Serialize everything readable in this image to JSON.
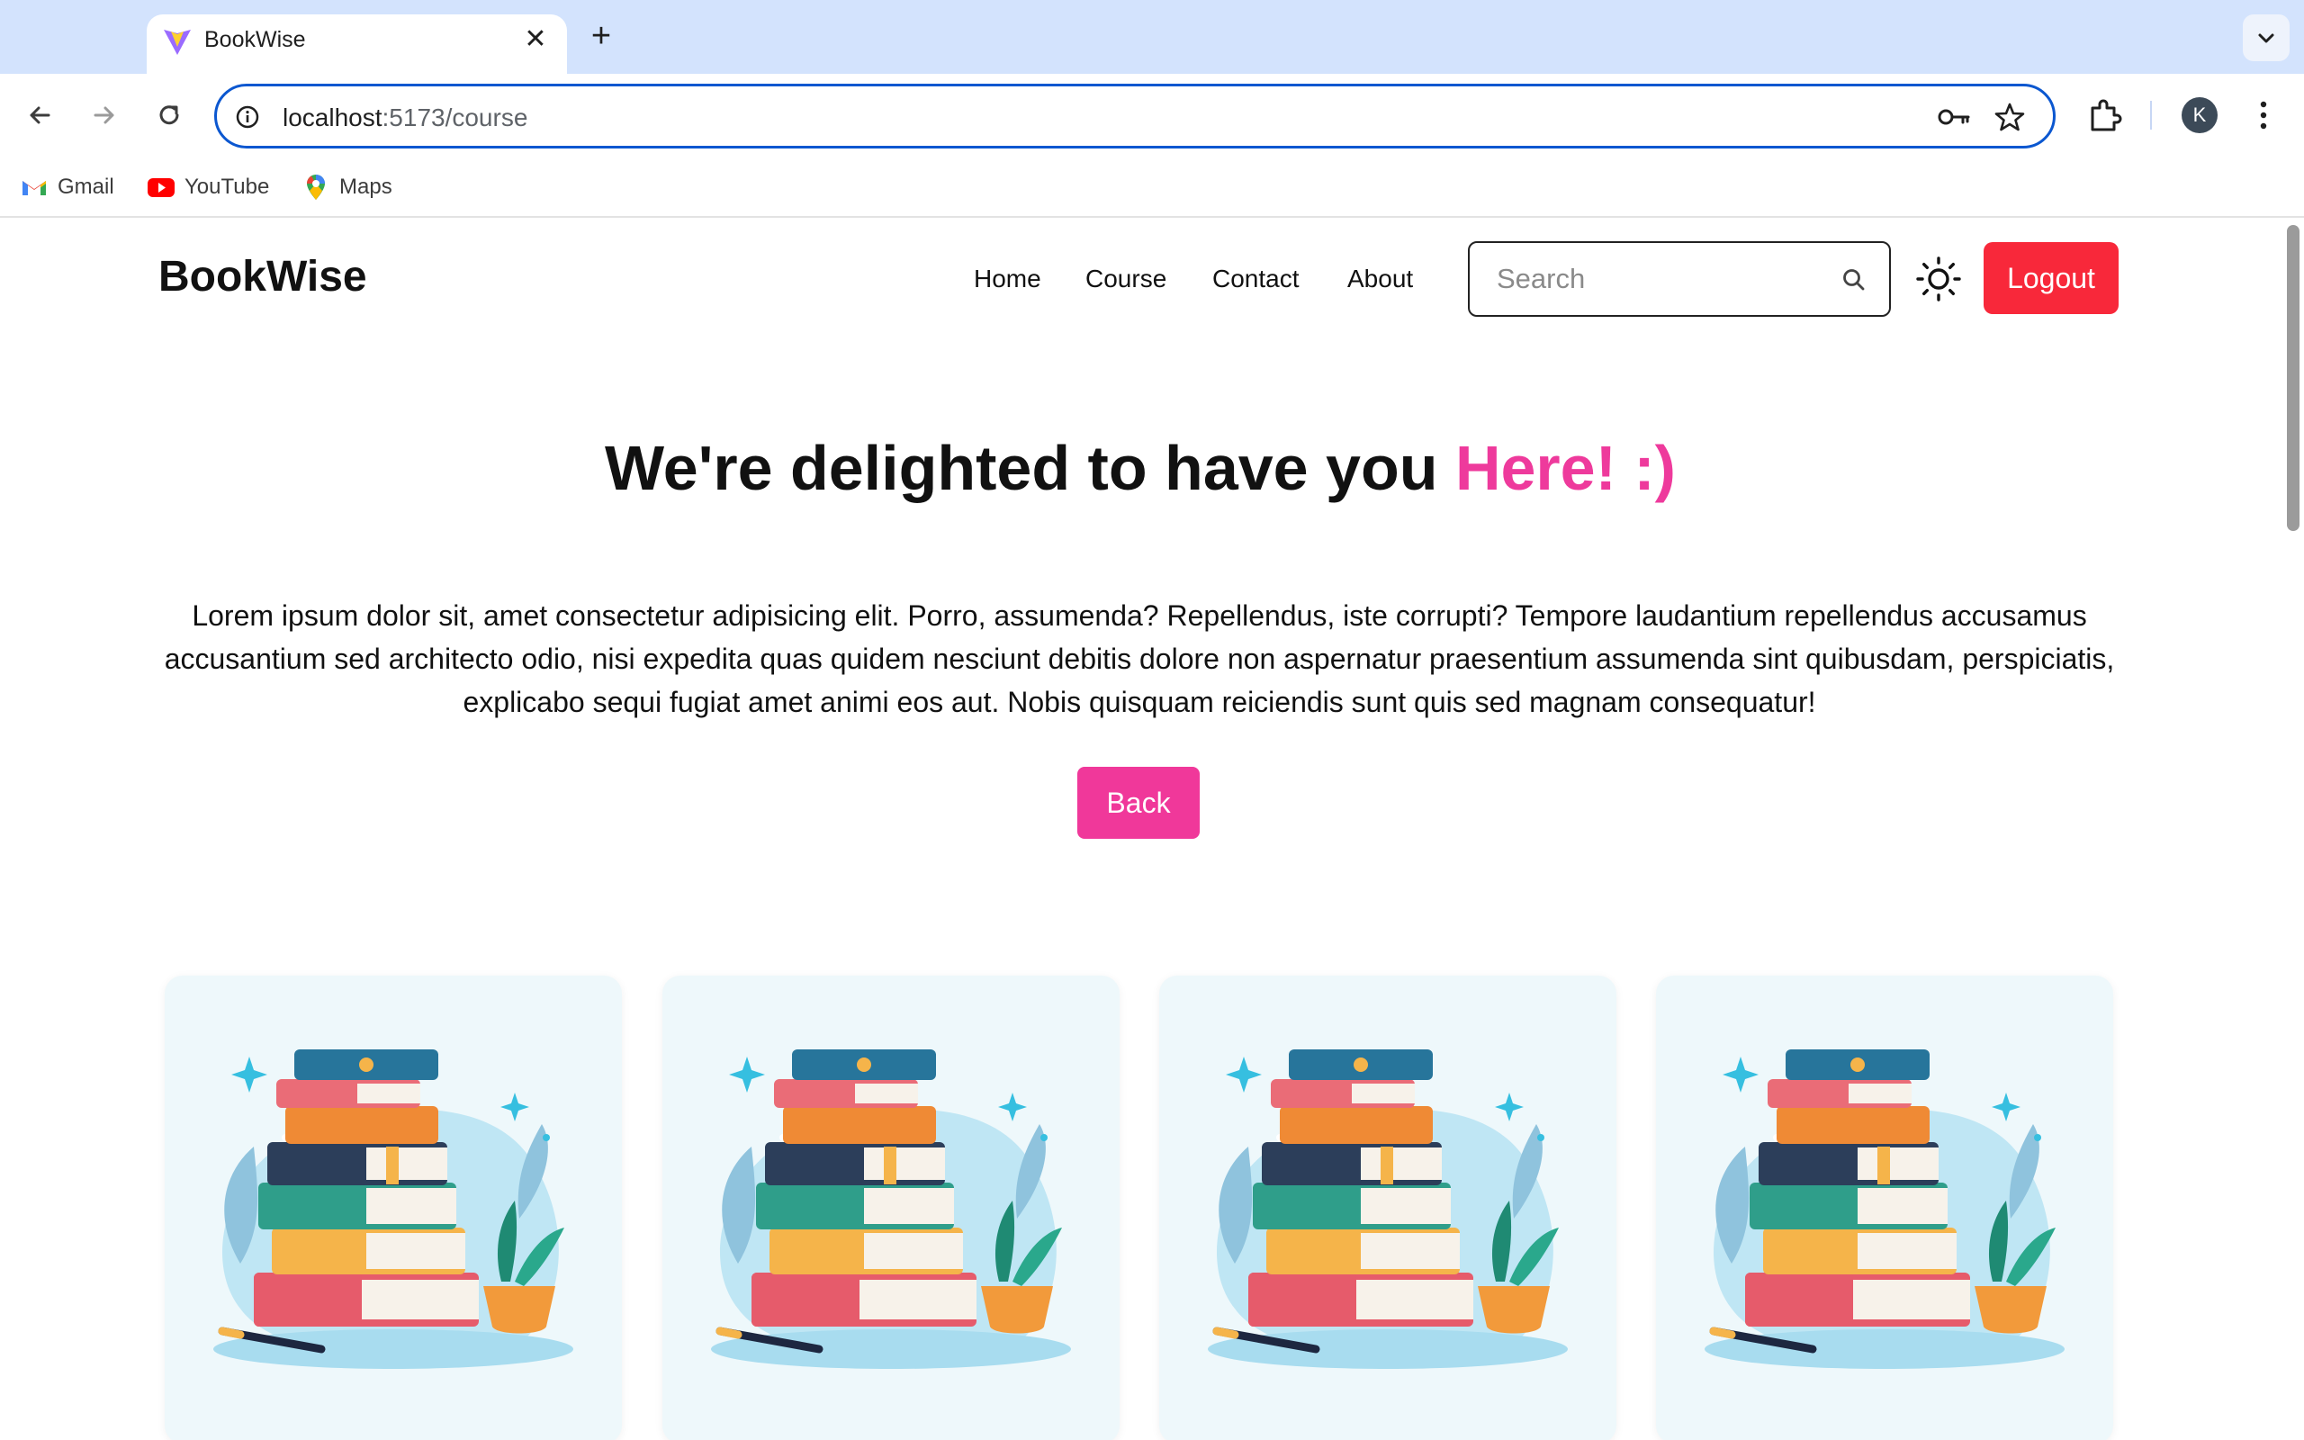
{
  "browser": {
    "tab_title": "BookWise",
    "url_host": "localhost",
    "url_rest": ":5173/course",
    "profile_initial": "K",
    "bookmarks": [
      {
        "label": "Gmail"
      },
      {
        "label": "YouTube"
      },
      {
        "label": "Maps"
      }
    ]
  },
  "site": {
    "brand": "BookWise",
    "nav": [
      "Home",
      "Course",
      "Contact",
      "About"
    ],
    "search_placeholder": "Search",
    "logout_label": "Logout",
    "colors": {
      "accent_pink": "#ee3a9c",
      "logout_red": "#f8283a"
    }
  },
  "hero": {
    "title_main": "We're delighted to have you ",
    "title_accent": "Here! :)",
    "body": "Lorem ipsum dolor sit, amet consectetur adipisicing elit. Porro, assumenda? Repellendus, iste corrupti? Tempore laudantium repellendus accusamus accusantium sed architecto odio, nisi expedita quas quidem nesciunt debitis dolore non aspernatur praesentium assumenda sint quibusdam, perspiciatis, explicabo sequi fugiat amet animi eos aut. Nobis quisquam reiciendis sunt quis sed magnam consequatur!",
    "back_label": "Back"
  },
  "cards": [
    {
      "image": "book-stack-illustration"
    },
    {
      "image": "book-stack-illustration"
    },
    {
      "image": "book-stack-illustration"
    },
    {
      "image": "book-stack-illustration"
    }
  ]
}
